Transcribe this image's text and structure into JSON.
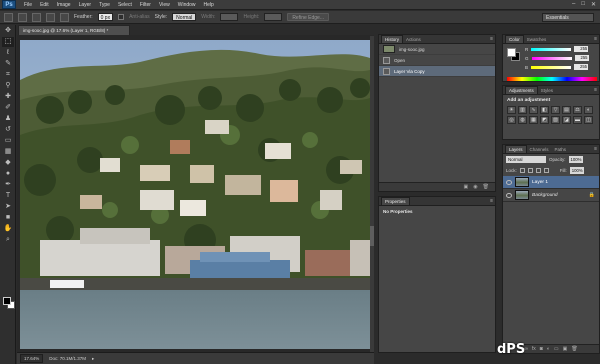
{
  "app": {
    "logo": "Ps"
  },
  "menu": [
    "File",
    "Edit",
    "Image",
    "Layer",
    "Type",
    "Select",
    "Filter",
    "View",
    "Window",
    "Help"
  ],
  "window_controls": [
    "–",
    "□",
    "✕"
  ],
  "options": {
    "feather_label": "Feather:",
    "feather_value": "0 px",
    "antialias_label": "Anti-alias",
    "style_label": "Style:",
    "style_value": "Normal",
    "width_label": "Width:",
    "height_label": "Height:",
    "refine_edge_label": "Refine Edge...",
    "workspace": "Essentials"
  },
  "document": {
    "tab_title": "img-sooc.jpg @ 17.6% (Layer 1, RGB/8) *",
    "zoom": "17.64%",
    "doc_info": "Doc: 70.1M/1.37M"
  },
  "history": {
    "tabs": [
      "History",
      "Actions"
    ],
    "snapshot": "img-sooc.jpg",
    "items": [
      "Open",
      "Layer Via Copy"
    ]
  },
  "properties": {
    "tabs": [
      "Properties"
    ],
    "body": "No Properties"
  },
  "color": {
    "tabs": [
      "Color",
      "Swatches"
    ],
    "channels": [
      {
        "label": "R",
        "value": "255"
      },
      {
        "label": "G",
        "value": "255"
      },
      {
        "label": "B",
        "value": "255"
      }
    ]
  },
  "adjustments": {
    "tabs": [
      "Adjustments",
      "Styles"
    ],
    "title": "Add an adjustment"
  },
  "layers": {
    "tabs": [
      "Layers",
      "Channels",
      "Paths"
    ],
    "blend_mode": "Normal",
    "opacity_label": "Opacity:",
    "opacity": "100%",
    "lock_label": "Lock:",
    "fill_label": "Fill:",
    "fill": "100%",
    "items": [
      {
        "name": "Layer 1",
        "selected": true
      },
      {
        "name": "Background",
        "selected": false
      }
    ]
  },
  "watermark": "dPS"
}
